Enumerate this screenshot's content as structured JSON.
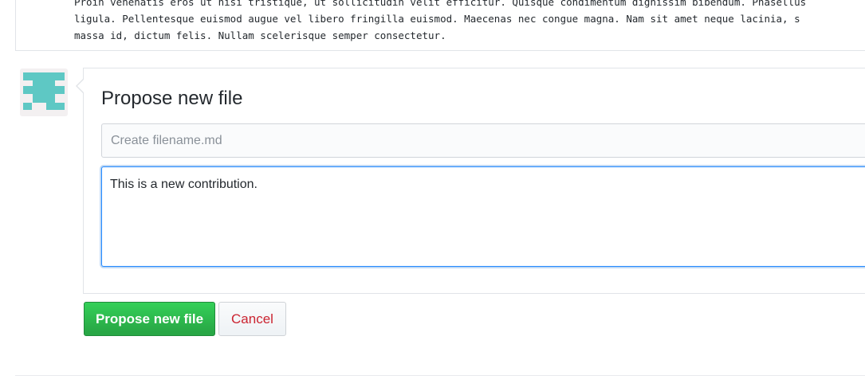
{
  "code_preview": {
    "lines": [
      "Proin venenatis eros ut nisi tristique, ut sollicitudin velit efficitur. Quisque condimentum dignissim bibendum. Phasellus",
      "ligula. Pellentesque euismod augue vel libero fringilla euismod. Maecenas nec congue magna. Nam sit amet neque lacinia, s",
      "massa id, dictum felis. Nullam scelerisque semper consectetur."
    ]
  },
  "avatar": {
    "icon": "identicon",
    "color": "#5ec8c4",
    "background": "#f3f0f1"
  },
  "form": {
    "title": "Propose new file",
    "filename": {
      "value": "",
      "placeholder": "Create filename.md"
    },
    "body": {
      "value": "This is a new contribution."
    }
  },
  "actions": {
    "propose_label": "Propose new file",
    "cancel_label": "Cancel"
  },
  "colors": {
    "primary_button": "#28a745",
    "cancel_text": "#cb2431",
    "focus_ring": "#2188ff",
    "identicon": "#5ec8c4"
  }
}
